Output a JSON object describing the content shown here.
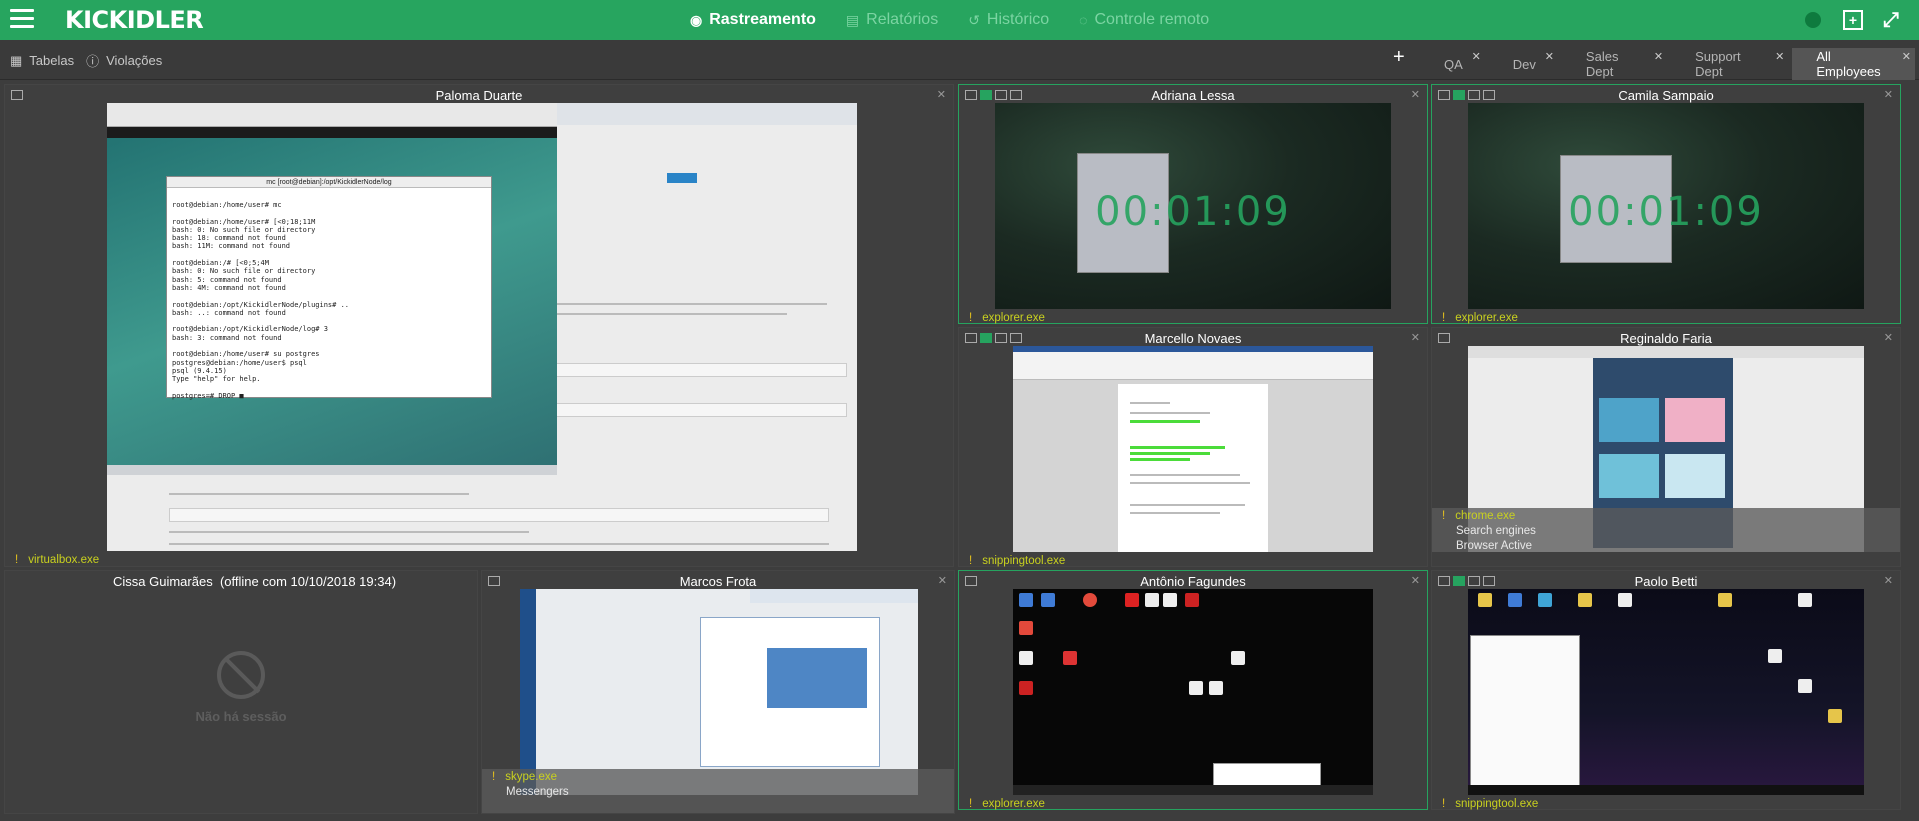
{
  "topbar": {
    "logo": "KICKIDLER",
    "nav": [
      {
        "label": "Rastreamento",
        "icon": "eye-icon",
        "active": true
      },
      {
        "label": "Relatórios",
        "icon": "report-icon",
        "active": false
      },
      {
        "label": "Histórico",
        "icon": "history-icon",
        "active": false
      },
      {
        "label": "Controle remoto",
        "icon": "remote-icon",
        "active": false
      }
    ]
  },
  "subbar": {
    "tables_label": "Tabelas",
    "violations_label": "Violações",
    "add_tab": "+",
    "tabs": [
      {
        "label": "QA",
        "active": false
      },
      {
        "label": "Dev",
        "active": false
      },
      {
        "label": "Sales Dept",
        "active": false
      },
      {
        "label": "Support Dept",
        "active": false
      },
      {
        "label": "All Employees",
        "active": true
      }
    ]
  },
  "cells": {
    "paloma": {
      "name": "Paloma Duarte",
      "process": "virtualbox.exe"
    },
    "adriana": {
      "name": "Adriana Lessa",
      "process": "explorer.exe",
      "timer": "00:01:09"
    },
    "camila": {
      "name": "Camila Sampaio",
      "process": "explorer.exe",
      "timer": "00:01:09"
    },
    "marcello": {
      "name": "Marcello Novaes",
      "process": "snippingtool.exe"
    },
    "reginaldo": {
      "name": "Reginaldo Faria",
      "process": "chrome.exe",
      "category": "Search engines",
      "status": "Browser Active"
    },
    "cissa": {
      "name": "Cissa Guimarães",
      "offline": "(offline com 10/10/2018 19:34)",
      "no_session": "Não há sessão"
    },
    "marcos": {
      "name": "Marcos Frota",
      "process": "skype.exe",
      "category": "Messengers"
    },
    "antonio": {
      "name": "Antônio Fagundes",
      "process": "explorer.exe"
    },
    "paolo": {
      "name": "Paolo Betti",
      "process": "snippingtool.exe"
    }
  },
  "terminal": {
    "title": "mc [root@debian]:/opt/KickidlerNode/log",
    "lines": "root@debian:/home/user# mc\n\nroot@debian:/home/user# [<0;18;11M\nbash: 0: No such file or directory\nbash: 18: command not found\nbash: 11M: command not found\n\nroot@debian:/# [<0;5;4M\nbash: 0: No such file or directory\nbash: 5: command not found\nbash: 4M: command not found\n\nroot@debian:/opt/KickidlerNode/plugins# ..\nbash: ..: command not found\n\nroot@debian:/opt/KickidlerNode/log# 3\nbash: 3: command not found\n\nroot@debian:/home/user# su postgres\npostgres@debian:/home/user$ psql\npsql (9.4.15)\nType \"help\" for help.\n\npostgres=# DROP ■"
  },
  "colors": {
    "brand": "#27a55f",
    "process": "#c9d11f",
    "timer": "#26a35f"
  }
}
